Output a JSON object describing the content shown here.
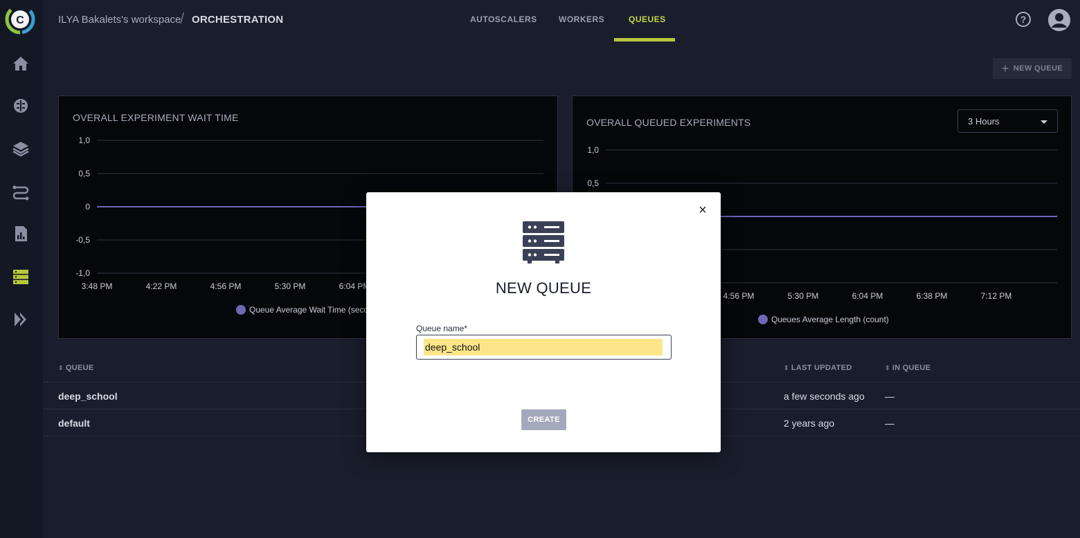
{
  "header": {
    "workspace": "ILYA Bakalets's workspace",
    "separator": "/",
    "title": "ORCHESTRATION",
    "tabs": [
      {
        "label": "AUTOSCALERS",
        "active": false
      },
      {
        "label": "WORKERS",
        "active": false
      },
      {
        "label": "QUEUES",
        "active": true
      }
    ],
    "help_icon": "?"
  },
  "sidebar": {
    "logo": "C",
    "items": [
      "home-icon",
      "brain-icon",
      "layers-icon",
      "pipelines-icon",
      "reports-icon",
      "orchestration-icon",
      "applications-icon"
    ]
  },
  "toolbar": {
    "new_queue_label": "NEW QUEUE",
    "plus": "+"
  },
  "charts": [
    {
      "title": "OVERALL EXPERIMENT WAIT TIME",
      "legend": "Queue Average Wait Time (seconds)"
    },
    {
      "title": "OVERALL QUEUED EXPERIMENTS",
      "legend": "Queues Average Length (count)",
      "range_select": "3 Hours"
    }
  ],
  "chart_data": [
    {
      "type": "line",
      "title": "OVERALL EXPERIMENT WAIT TIME",
      "ylim": [
        -1.0,
        1.0
      ],
      "y_ticks": [
        "1,0",
        "0,5",
        "0",
        "-0,5",
        "-1,0"
      ],
      "x_ticks": [
        "3:48 PM",
        "4:22 PM",
        "4:56 PM",
        "5:30 PM",
        "6:04 PM"
      ],
      "series": [
        {
          "name": "Queue Average Wait Time (seconds)",
          "x": [
            "3:48 PM",
            "6:04 PM"
          ],
          "values": [
            0,
            0
          ]
        }
      ],
      "grid": true,
      "legend_position": "bottom"
    },
    {
      "type": "line",
      "title": "OVERALL QUEUED EXPERIMENTS",
      "ylim": [
        -1.0,
        1.0
      ],
      "y_ticks": [
        "1,0",
        "0,5"
      ],
      "x_ticks": [
        "4:56 PM",
        "5:30 PM",
        "6:04 PM",
        "6:38 PM",
        "7:12 PM"
      ],
      "series": [
        {
          "name": "Queues Average Length (count)",
          "x": [
            "4:56 PM",
            "7:12 PM"
          ],
          "values": [
            0,
            0
          ]
        }
      ],
      "grid": true,
      "legend_position": "bottom"
    }
  ],
  "table": {
    "columns": [
      "QUEUE",
      "LAST UPDATED",
      "IN QUEUE"
    ],
    "sort_glyph": "⇕",
    "rows": [
      {
        "queue": "deep_school",
        "last_updated": "a few seconds ago",
        "in_queue": "—"
      },
      {
        "queue": "default",
        "last_updated": "2 years ago",
        "in_queue": "—"
      }
    ]
  },
  "modal": {
    "title": "NEW QUEUE",
    "close": "×",
    "field_label": "Queue name*",
    "field_value": "deep_school",
    "create_label": "CREATE"
  },
  "colors": {
    "accent": "#b7c83c",
    "series": "#6e67b8",
    "highlight": "#fde68a"
  }
}
